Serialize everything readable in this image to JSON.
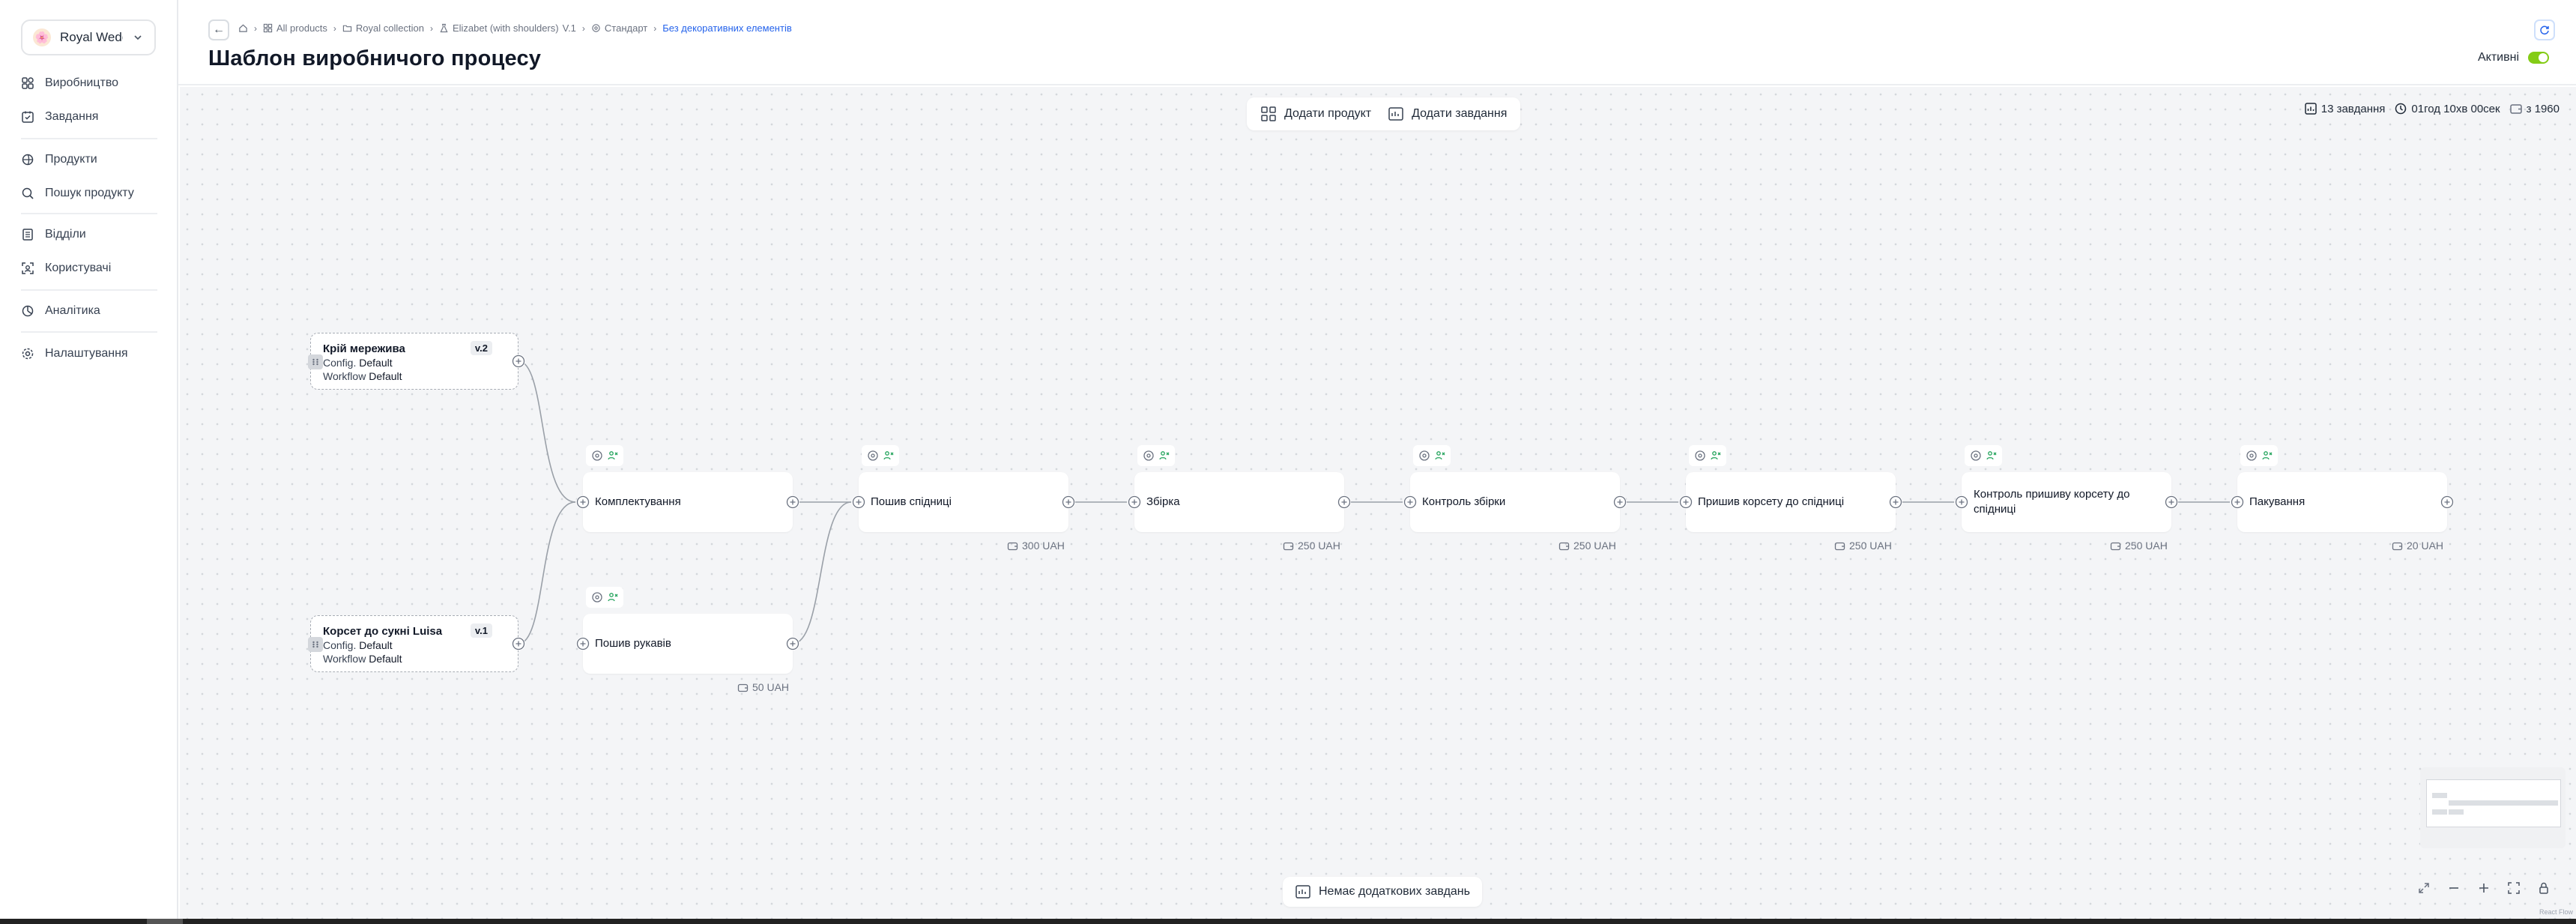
{
  "sidebar": {
    "workspace": {
      "logo": "🌸",
      "name": "Royal Weddi..."
    },
    "items": [
      {
        "label": "Виробництво",
        "icon": "production-icon"
      },
      {
        "label": "Завдання",
        "icon": "tasks-icon"
      },
      {
        "label": "Продукти",
        "icon": "products-icon"
      },
      {
        "label": "Пошук продукту",
        "icon": "product-search-icon"
      },
      {
        "label": "Відділи",
        "icon": "departments-icon"
      },
      {
        "label": "Користувачі",
        "icon": "users-icon"
      },
      {
        "label": "Аналітика",
        "icon": "analytics-icon"
      },
      {
        "label": "Налаштування",
        "icon": "settings-icon"
      }
    ]
  },
  "header": {
    "back": "←",
    "breadcrumbs": {
      "all_products": "All products",
      "collection": "Royal collection",
      "product": "Elizabet (with shoulders)",
      "version": "V.1",
      "standard": "Стандарт",
      "current": "Без декоративних елементів"
    },
    "title": "Шаблон виробничого процесу",
    "active_label": "Активні",
    "active": true
  },
  "toolbar": {
    "add_product": "Додати продукт",
    "add_task": "Додати завдання"
  },
  "stats": {
    "tasks": "13 завдання",
    "duration": "01год 10хв 00сек",
    "price": "з 1960"
  },
  "products": [
    {
      "title": "Крій мережива",
      "version": "v.2",
      "config_label": "Config.",
      "config": "Default",
      "workflow_label": "Workflow",
      "workflow": "Default"
    },
    {
      "title": "Корсет до сукні Luisa",
      "version": "v.1",
      "config_label": "Config.",
      "config": "Default",
      "workflow_label": "Workflow",
      "workflow": "Default"
    }
  ],
  "tasks": [
    {
      "label": "Комплектування",
      "price": ""
    },
    {
      "label": "Пошив спідниці",
      "price": "300 UAH"
    },
    {
      "label": "Збірка",
      "price": "250 UAH"
    },
    {
      "label": "Контроль збірки",
      "price": "250 UAH"
    },
    {
      "label": "Пришив корсету до спідниці",
      "price": "250 UAH"
    },
    {
      "label": "Контроль пришиву корсету до спідниці",
      "price": "250 UAH"
    },
    {
      "label": "Пакування",
      "price": "20 UAH"
    },
    {
      "label": "Пошив рукавів",
      "price": "50 UAH"
    }
  ],
  "bottom": {
    "no_extra_tasks": "Немає додаткових завдань"
  },
  "attribution": "React Flow",
  "colors": {
    "accent": "#2563eb",
    "toggle": "#84cc16",
    "canvas": "#f4f5f7"
  }
}
